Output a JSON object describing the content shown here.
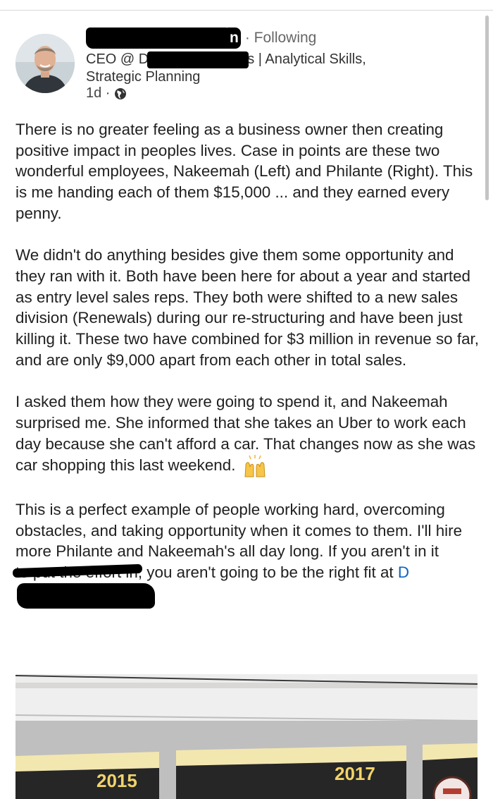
{
  "header": {
    "name_visible_tail": "n",
    "follow_status": "· Following",
    "headline_prefix": "CEO @ D",
    "headline_mid": "s | Analytical Skills,",
    "headline_line2": "Strategic Planning",
    "post_age": "1d ·",
    "visibility_icon": "globe-icon"
  },
  "post": {
    "paragraphs": [
      "There is no greater feeling as a business owner then creating positive impact in peoples lives. Case in points are these two wonderful employees, Nakeemah (Left) and Philante (Right). This is me handing each of them $15,000 ... and they earned every penny.",
      "We didn't do anything besides give them some opportunity and they ran with it. Both have been here for about a year and started as entry level sales reps. They both were shifted to a new sales division (Renewals) during our re-structuring and have been just killing it. These two have combined for $3 million in revenue so far, and are only $9,000 apart from each other in total sales.",
      "I asked them how they were going to spend it, and Nakeemah surprised me. She informed that she takes an Uber to work each day because she can't afford a car. That changes now as she was car shopping this last weekend."
    ],
    "emoji": "raising-hands-emoji",
    "last_paragraph_before": "This is a perfect example of people working hard, overcoming obstacles, and taking opportunity when it comes to them. I'll hire more Philante and Nakeemah's all day long. If you aren't in it ",
    "last_paragraph_struck": "to put the effort in",
    "last_paragraph_after": ", you aren't going to be the right fit at ",
    "company_link_start": "D"
  },
  "photo": {
    "banner_years": [
      "2015",
      "2017"
    ]
  }
}
